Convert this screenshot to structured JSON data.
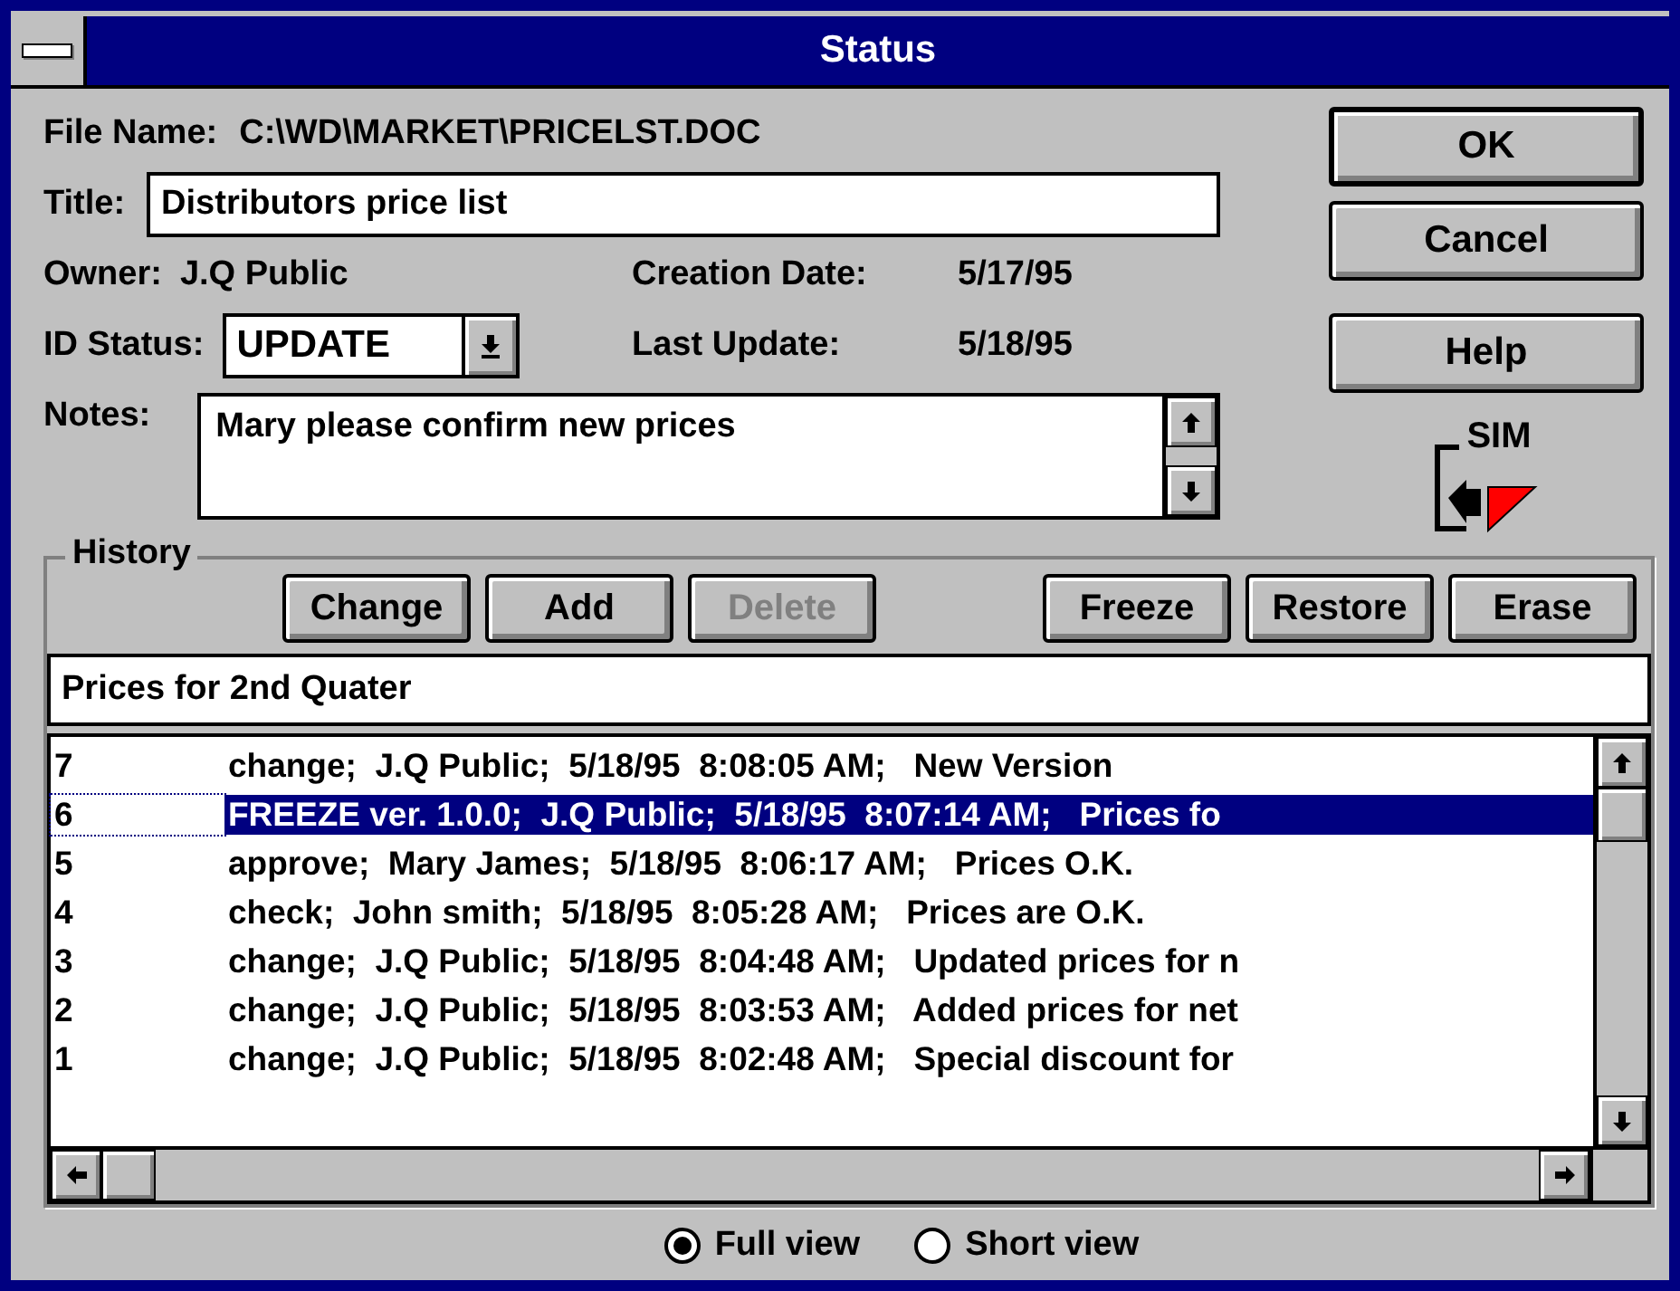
{
  "window": {
    "title": "Status"
  },
  "file_name": {
    "label": "File Name:",
    "value": "C:\\WD\\MARKET\\PRICELST.DOC"
  },
  "title_field": {
    "label": "Title:",
    "value": "Distributors price list"
  },
  "owner": {
    "label": "Owner:",
    "value": "J.Q Public"
  },
  "creation_date": {
    "label": "Creation Date:",
    "value": "5/17/95"
  },
  "id_status": {
    "label": "ID Status:",
    "value": "UPDATE"
  },
  "last_update": {
    "label": "Last Update:",
    "value": "5/18/95"
  },
  "notes": {
    "label": "Notes:",
    "value": "Mary please confirm new prices"
  },
  "buttons": [
    {
      "label": "OK",
      "default": true
    },
    {
      "label": "Cancel",
      "default": false
    },
    {
      "label": "Help",
      "default": false
    }
  ],
  "logo": {
    "text": "SIM"
  },
  "history": {
    "label": "History",
    "edit_buttons": [
      {
        "label": "Change",
        "disabled": false
      },
      {
        "label": "Add",
        "disabled": false
      },
      {
        "label": "Delete",
        "disabled": true
      }
    ],
    "version_buttons": [
      {
        "label": "Freeze",
        "disabled": false
      },
      {
        "label": "Restore",
        "disabled": false
      },
      {
        "label": "Erase",
        "disabled": false
      }
    ],
    "comment": "Prices for 2nd Quater",
    "rows": [
      {
        "number": "7",
        "text": "change;  J.Q Public;  5/18/95  8:08:05 AM;   New Version",
        "selected": false
      },
      {
        "number": "6",
        "text": "FREEZE ver. 1.0.0;  J.Q Public;  5/18/95  8:07:14 AM;   Prices fo",
        "selected": true
      },
      {
        "number": "5",
        "text": "approve;  Mary James;  5/18/95  8:06:17 AM;   Prices O.K.",
        "selected": false
      },
      {
        "number": "4",
        "text": "check;  John smith;  5/18/95  8:05:28 AM;   Prices are O.K.",
        "selected": false
      },
      {
        "number": "3",
        "text": "change;  J.Q Public;  5/18/95  8:04:48 AM;   Updated prices for n",
        "selected": false
      },
      {
        "number": "2",
        "text": "change;  J.Q Public;  5/18/95  8:03:53 AM;   Added prices for net",
        "selected": false
      },
      {
        "number": "1",
        "text": "change;  J.Q Public;  5/18/95  8:02:48 AM;   Special discount for",
        "selected": false
      }
    ]
  },
  "view_options": [
    {
      "label": "Full view",
      "selected": true
    },
    {
      "label": "Short view",
      "selected": false
    }
  ]
}
